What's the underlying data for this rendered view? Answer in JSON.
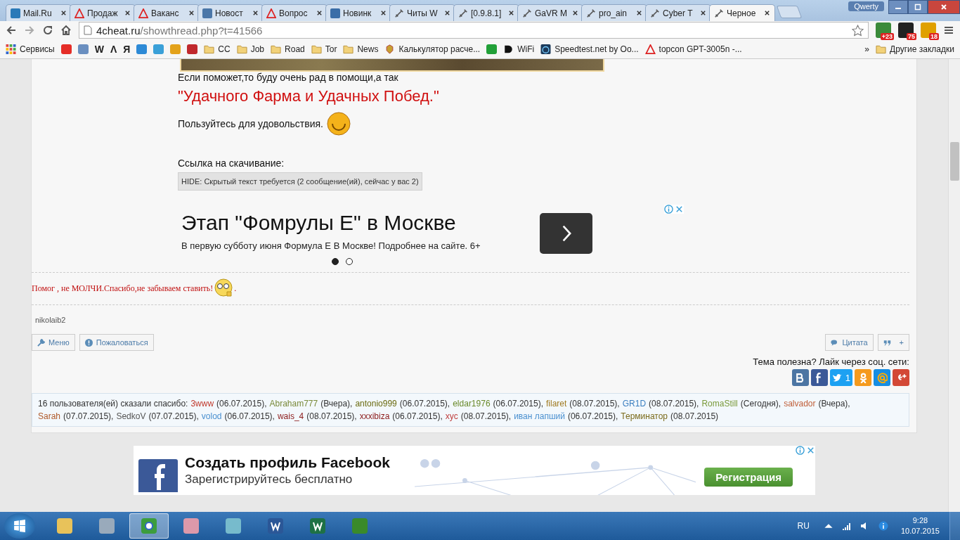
{
  "tabs": [
    {
      "kind": "mail",
      "label": "Mail.Ru",
      "selected": false
    },
    {
      "kind": "warning",
      "label": "Продаж",
      "selected": false
    },
    {
      "kind": "warning",
      "label": "Ваканс",
      "selected": false
    },
    {
      "kind": "vk",
      "label": "Новост",
      "selected": false
    },
    {
      "kind": "warning",
      "label": "Вопрос",
      "selected": false
    },
    {
      "kind": "tile",
      "label": "Новинк",
      "selected": false
    },
    {
      "kind": "sword",
      "label": "Читы W",
      "selected": false
    },
    {
      "kind": "sword",
      "label": "[0.9.8.1]",
      "selected": false
    },
    {
      "kind": "sword",
      "label": "GaVR M",
      "selected": false
    },
    {
      "kind": "sword",
      "label": "pro_ain",
      "selected": false
    },
    {
      "kind": "sword",
      "label": "Cyber T",
      "selected": false
    },
    {
      "kind": "sword",
      "label": "Черное",
      "selected": true
    }
  ],
  "profile": "Qwerty",
  "toolbar": {
    "url_host": "4cheat.ru",
    "url_path": "/showthread.php?t=41566",
    "badges": [
      "+23",
      "75",
      "18"
    ]
  },
  "bookmarks": [
    {
      "kind": "apps",
      "label": "Сервисы"
    },
    {
      "kind": "video"
    },
    {
      "kind": "mail"
    },
    {
      "kind": "glyph",
      "label": "W"
    },
    {
      "kind": "glyph",
      "label": "Λ"
    },
    {
      "kind": "glyph",
      "label": "Я"
    },
    {
      "kind": "windows"
    },
    {
      "kind": "drop"
    },
    {
      "kind": "ring"
    },
    {
      "kind": "star"
    },
    {
      "kind": "folder",
      "label": "CC"
    },
    {
      "kind": "folder",
      "label": "Job"
    },
    {
      "kind": "folder",
      "label": "Road"
    },
    {
      "kind": "folder",
      "label": "Tor"
    },
    {
      "kind": "folder",
      "label": "News"
    },
    {
      "kind": "emblem",
      "label": "Калькулятор расче..."
    },
    {
      "kind": "leaf"
    },
    {
      "kind": "dee",
      "label": "WiFi"
    },
    {
      "kind": "gauge",
      "label": "Speedtest.net by Oo..."
    },
    {
      "kind": "warning",
      "label": "topcon GPT-3005n -..."
    }
  ],
  "bookmarks_more": "»",
  "other_bookmarks": "Другие закладки",
  "post": {
    "line1": "Если поможет,то буду очень рад в помощи,а так",
    "slogan": "\"Удачного Фарма и Удачных Побед.\"",
    "enjoy": "Пользуйтесь для удовольствия.",
    "download_label": "Ссылка на скачивание:",
    "hidden_notice": "HIDE: Скрытый текст требуется (2 сообщение(ий), сейчас у вас 2)",
    "ad": {
      "title": "Этап \"Фомрулы Е\" в Москве",
      "text": "В первую субботу июня Формула Е В Москве! Подробнее на сайте. 6+",
      "dots": [
        {
          "selected": true
        },
        {
          "selected": false
        }
      ]
    },
    "signature": "Помог , не МОЛЧИ.Спасибо,не забываем ставить!",
    "signature_end": ".",
    "username": "nikolaib2",
    "left_buttons": [
      "Меню",
      "Пожаловаться"
    ],
    "quote_button": "Цитата",
    "multiquote_button": "+",
    "social_prompt": "Тема полезна? Лайк через соц. сети:",
    "twitter_count": "1",
    "thanks_intro": "16 пользователя(ей) сказали спасибо:",
    "thanks": [
      {
        "name": "3www",
        "date": "(06.07.2015),",
        "color": "#c0392b"
      },
      {
        "name": "Abraham777",
        "date": "(Вчера),",
        "color": "#7a8a3a"
      },
      {
        "name": "antonio999",
        "date": "(06.07.2015),",
        "color": "#6b6b10"
      },
      {
        "name": "eldar1976",
        "date": "(06.07.2015),",
        "color": "#6a8a2a"
      },
      {
        "name": "filaret",
        "date": "(08.07.2015),",
        "color": "#a07a20"
      },
      {
        "name": "GR1D",
        "date": "(08.07.2015),",
        "color": "#3b7fc0"
      },
      {
        "name": "RomaStill",
        "date": "(Сегодня),",
        "color": "#7a9a3a"
      },
      {
        "name": "salvador",
        "date": "(Вчера),",
        "color": "#c0603a"
      },
      {
        "name": "Sarah",
        "date": "(07.07.2015),",
        "color": "#b05a2a"
      },
      {
        "name": "SedkoV",
        "date": "(07.07.2015),",
        "color": "#555555"
      },
      {
        "name": "volod",
        "date": "(06.07.2015),",
        "color": "#4a90d0"
      },
      {
        "name": "wais_4",
        "date": "(08.07.2015),",
        "color": "#8b1a1a"
      },
      {
        "name": "xxxibiza",
        "date": "(06.07.2015),",
        "color": "#8b1a1a"
      },
      {
        "name": "xyc",
        "date": "(08.07.2015),",
        "color": "#c04040"
      },
      {
        "name": "иван лапший",
        "date": "(06.07.2015),",
        "color": "#4a90d0"
      },
      {
        "name": "Терминатор",
        "date": "(08.07.2015)",
        "color": "#7a6a1a"
      }
    ]
  },
  "fb_ad": {
    "title": "Создать профиль Facebook",
    "subtitle": "Зарегистрируйтесь бесплатно",
    "button": "Регистрация"
  },
  "taskbar": {
    "apps": [
      {
        "kind": "folder",
        "selected": false
      },
      {
        "kind": "calculator",
        "selected": false
      },
      {
        "kind": "browser",
        "selected": true
      },
      {
        "kind": "paint",
        "selected": false
      },
      {
        "kind": "notepad",
        "selected": false
      },
      {
        "kind": "word",
        "selected": false
      },
      {
        "kind": "excel",
        "selected": false
      },
      {
        "kind": "terminal",
        "selected": false
      }
    ],
    "language": "RU",
    "time": "9:28",
    "date": "10.07.2015"
  }
}
